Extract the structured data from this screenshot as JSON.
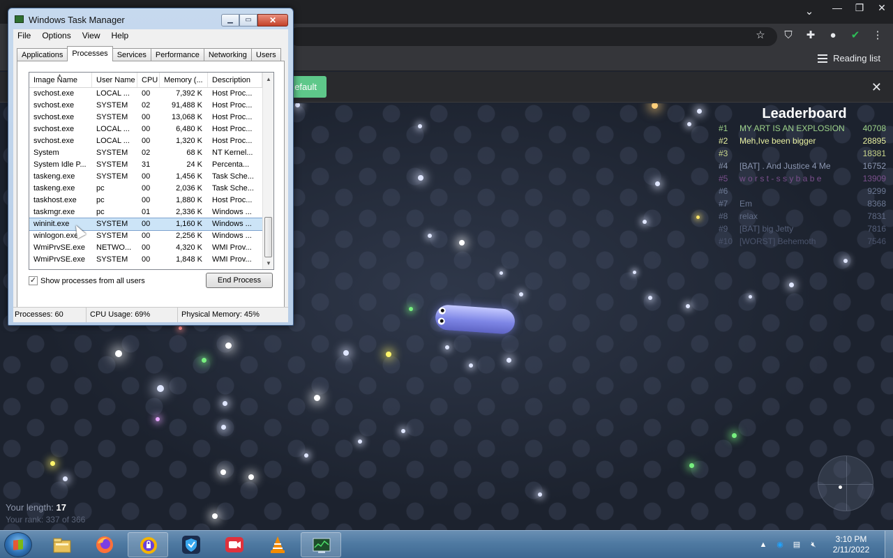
{
  "browser": {
    "default_button_label": "efault",
    "reading_list_label": "Reading list",
    "icons": [
      "star-icon",
      "adblock-icon",
      "extensions-icon",
      "profile-icon",
      "shield-check-icon",
      "more-menu-icon"
    ]
  },
  "game": {
    "leaderboard": {
      "title": "Leaderboard",
      "rows": [
        {
          "rank": "#1",
          "name": "MY ART IS AN EXPLOSION",
          "score": "40708",
          "color": "#9ed48a"
        },
        {
          "rank": "#2",
          "name": "Meh,Ive been bigger",
          "score": "28895",
          "color": "#e8f0a0"
        },
        {
          "rank": "#3",
          "name": "",
          "score": "18381",
          "color": "#c9d68c"
        },
        {
          "rank": "#4",
          "name": "[BAT] . And Justice 4 Me",
          "score": "16752",
          "color": "#8d98b3"
        },
        {
          "rank": "#5",
          "name": "w o r s t - s s y b a b e",
          "score": "13909",
          "color": "#7a4f8c"
        },
        {
          "rank": "#6",
          "name": "",
          "score": "9299",
          "color": "#6c7893"
        },
        {
          "rank": "#7",
          "name": "Em",
          "score": "8368",
          "color": "#6c7893"
        },
        {
          "rank": "#8",
          "name": "relax",
          "score": "7831",
          "color": "#616c86"
        },
        {
          "rank": "#9",
          "name": "[BAT] big Jetty",
          "score": "7816",
          "color": "#56607a"
        },
        {
          "rank": "#10",
          "name": "[WORST] Behemoth",
          "score": "7546",
          "color": "#4b546c"
        }
      ]
    },
    "length_label": "Your length: ",
    "length_value": "17",
    "rank_label": "Your rank: 337 of 366"
  },
  "taskmgr": {
    "title": "Windows Task Manager",
    "menu": [
      "File",
      "Options",
      "View",
      "Help"
    ],
    "tabs": [
      "Applications",
      "Processes",
      "Services",
      "Performance",
      "Networking",
      "Users"
    ],
    "active_tab": "Processes",
    "columns": [
      "Image Name",
      "User Name",
      "CPU",
      "Memory (...",
      "Description"
    ],
    "rows": [
      {
        "name": "svchost.exe",
        "user": "LOCAL ...",
        "cpu": "00",
        "mem": "7,392 K",
        "desc": "Host Proc..."
      },
      {
        "name": "svchost.exe",
        "user": "SYSTEM",
        "cpu": "02",
        "mem": "91,488 K",
        "desc": "Host Proc..."
      },
      {
        "name": "svchost.exe",
        "user": "SYSTEM",
        "cpu": "00",
        "mem": "13,068 K",
        "desc": "Host Proc..."
      },
      {
        "name": "svchost.exe",
        "user": "LOCAL ...",
        "cpu": "00",
        "mem": "6,480 K",
        "desc": "Host Proc..."
      },
      {
        "name": "svchost.exe",
        "user": "LOCAL ...",
        "cpu": "00",
        "mem": "1,320 K",
        "desc": "Host Proc..."
      },
      {
        "name": "System",
        "user": "SYSTEM",
        "cpu": "02",
        "mem": "68 K",
        "desc": "NT Kernel..."
      },
      {
        "name": "System Idle P...",
        "user": "SYSTEM",
        "cpu": "31",
        "mem": "24 K",
        "desc": "Percenta..."
      },
      {
        "name": "taskeng.exe",
        "user": "SYSTEM",
        "cpu": "00",
        "mem": "1,456 K",
        "desc": "Task Sche..."
      },
      {
        "name": "taskeng.exe",
        "user": "pc",
        "cpu": "00",
        "mem": "2,036 K",
        "desc": "Task Sche..."
      },
      {
        "name": "taskhost.exe",
        "user": "pc",
        "cpu": "00",
        "mem": "1,880 K",
        "desc": "Host Proc..."
      },
      {
        "name": "taskmgr.exe",
        "user": "pc",
        "cpu": "01",
        "mem": "2,336 K",
        "desc": "Windows ..."
      },
      {
        "name": "wininit.exe",
        "user": "SYSTEM",
        "cpu": "00",
        "mem": "1,160 K",
        "desc": "Windows ...",
        "selected": true
      },
      {
        "name": "winlogon.exe",
        "user": "SYSTEM",
        "cpu": "00",
        "mem": "2,256 K",
        "desc": "Windows ..."
      },
      {
        "name": "WmiPrvSE.exe",
        "user": "NETWO...",
        "cpu": "00",
        "mem": "4,320 K",
        "desc": "WMI Prov..."
      },
      {
        "name": "WmiPrvSE.exe",
        "user": "SYSTEM",
        "cpu": "00",
        "mem": "1,848 K",
        "desc": "WMI Prov..."
      }
    ],
    "show_all_label": "Show processes from all users",
    "show_all_checked": true,
    "end_process_label": "End Process",
    "status": {
      "processes": "Processes: 60",
      "cpu": "CPU Usage: 69%",
      "memory": "Physical Memory: 45%"
    }
  },
  "taskbar": {
    "apps": [
      "windows-explorer-icon",
      "firefox-icon",
      "vpn-lock-icon",
      "shield-app-icon",
      "screen-recorder-icon",
      "vlc-icon",
      "task-manager-icon"
    ],
    "clock_time": "3:10 PM",
    "clock_date": "2/11/2022"
  }
}
